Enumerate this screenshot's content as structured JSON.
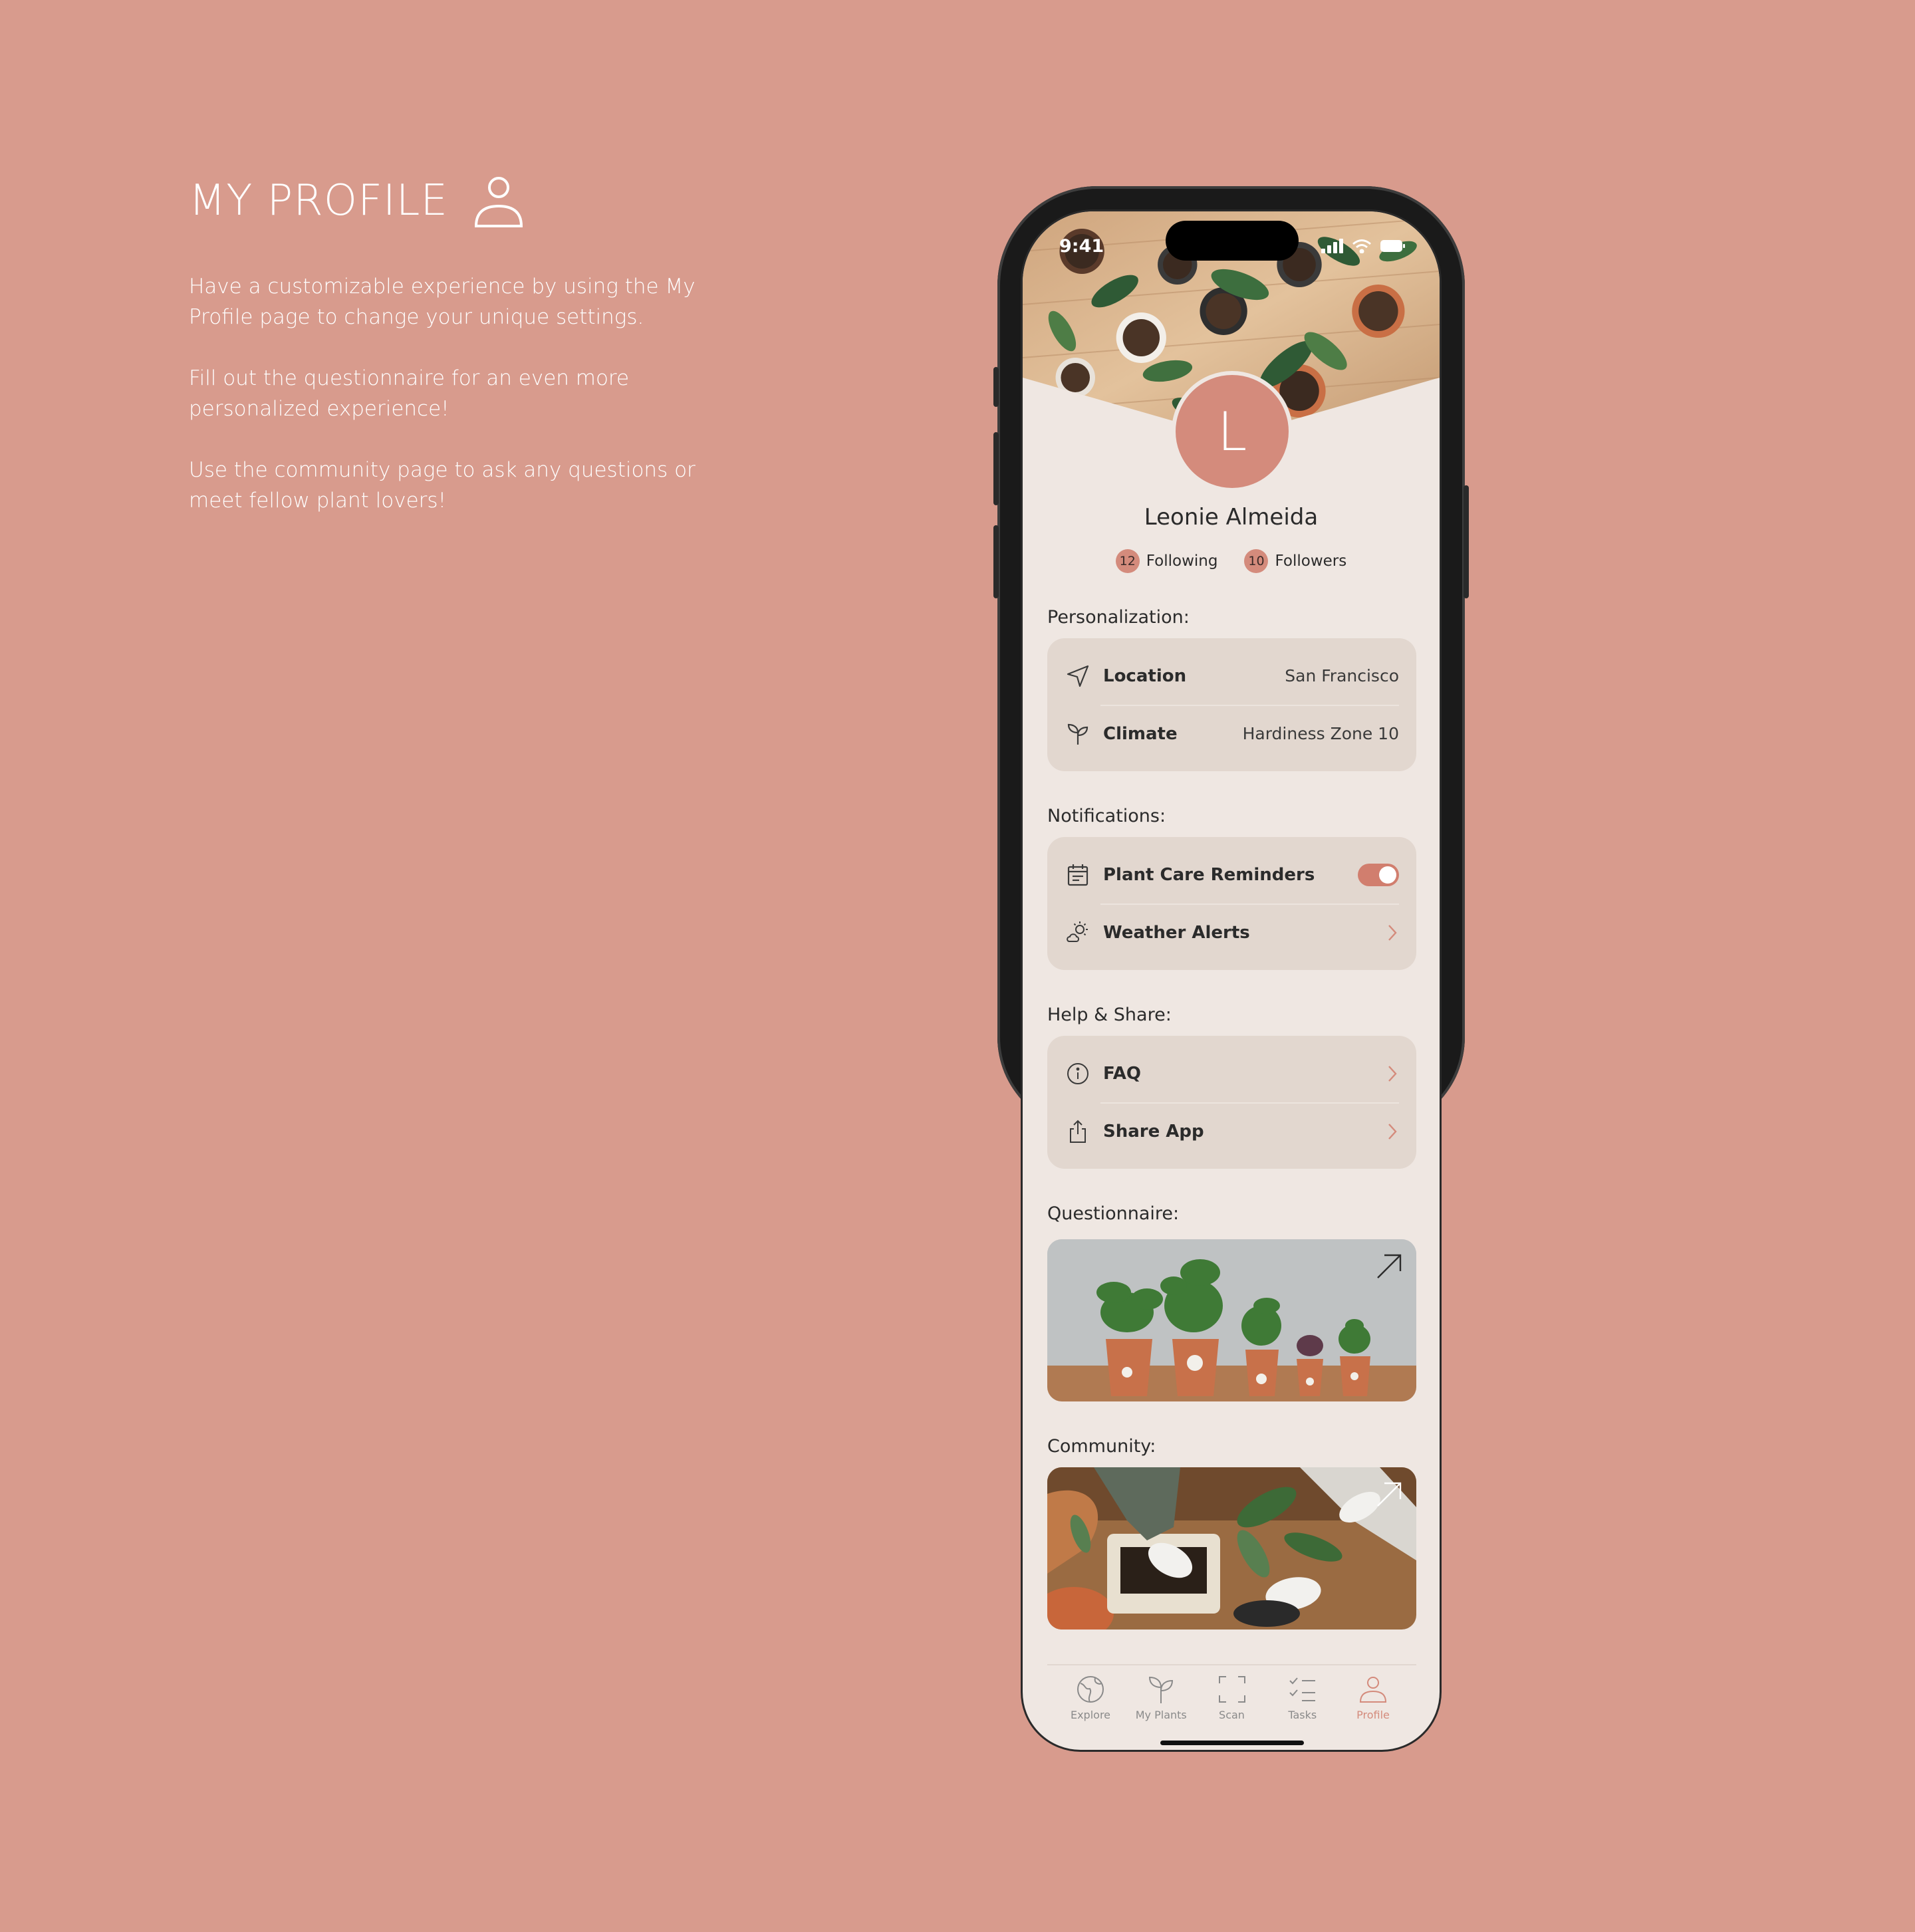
{
  "promo": {
    "title": "MY PROFILE",
    "title_icon": "user-icon",
    "paragraphs": [
      "Have a customizable experience by using the My Profile page to change your unique settings.",
      "Fill out the questionnaire for an even more personalized experience!",
      "Use the community page to ask any questions or meet fellow plant lovers!"
    ]
  },
  "status_bar": {
    "time": "9:41"
  },
  "profile": {
    "initial": "L",
    "name": "Leonie Almeida",
    "following_count": "12",
    "following_label": "Following",
    "followers_count": "10",
    "followers_label": "Followers"
  },
  "personalization": {
    "label": "Personalization:",
    "rows": [
      {
        "label": "Location",
        "value": "San Francisco",
        "icon": "navigation-arrow-icon"
      },
      {
        "label": "Climate",
        "value": "Hardiness Zone 10",
        "icon": "sprout-icon"
      }
    ]
  },
  "notifications": {
    "label": "Notifications:",
    "rows": [
      {
        "label": "Plant Care Reminders",
        "icon": "calendar-icon",
        "toggle_on": true
      },
      {
        "label": "Weather Alerts",
        "icon": "sun-cloud-icon"
      }
    ]
  },
  "help_share": {
    "label": "Help & Share:",
    "rows": [
      {
        "label": "FAQ",
        "icon": "info-icon"
      },
      {
        "label": "Share App",
        "icon": "share-icon"
      }
    ]
  },
  "questionnaire": {
    "label": "Questionnaire:"
  },
  "community": {
    "label": "Community:"
  },
  "tabbar": {
    "tabs": [
      {
        "label": "Explore",
        "icon": "globe-icon"
      },
      {
        "label": "My Plants",
        "icon": "sprout-icon"
      },
      {
        "label": "Scan",
        "icon": "scan-frame-icon"
      },
      {
        "label": "Tasks",
        "icon": "checklist-icon"
      },
      {
        "label": "Profile",
        "icon": "user-icon",
        "active": true
      }
    ]
  },
  "colors": {
    "background": "#d89b8d",
    "accent": "#d48b7c",
    "screen": "#efe7e2",
    "card": "#e2d7cf"
  }
}
